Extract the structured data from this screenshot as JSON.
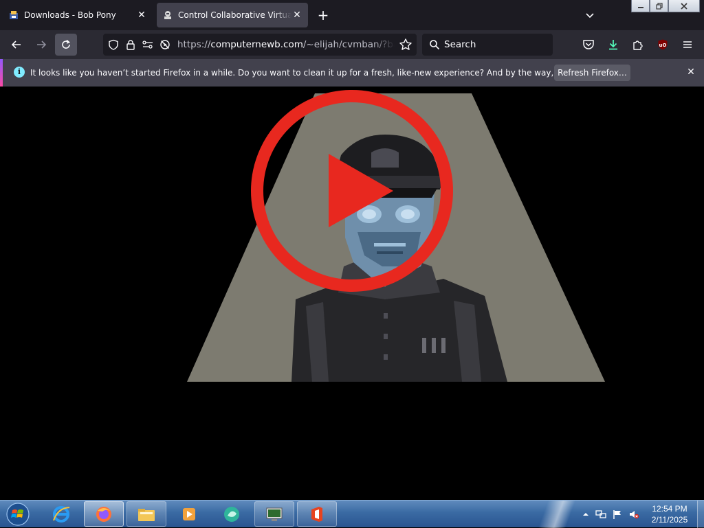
{
  "browser": {
    "tabs": [
      {
        "title": "Downloads - Bob Pony",
        "active": false
      },
      {
        "title": "Control Collaborative Virtual M",
        "active": true
      }
    ],
    "url": {
      "scheme": "https://",
      "host": "computernewb.com",
      "path": "/~elijah/cvmban/?banre"
    },
    "search_placeholder": "Search",
    "extension_badge_count": "2",
    "notification": {
      "text": "It looks like you haven’t started Firefox in a while. Do you want to clean it up for a fresh, like-new experience? And by the way, welcome back!",
      "button_label": "Refresh Firefox…"
    }
  },
  "content": {
    "video_overlay": "play-button-icon",
    "colors": {
      "play_red": "#e8281f",
      "spotlight": "#7d7b70",
      "face_blue": "#6f8fab"
    }
  },
  "taskbar": {
    "apps": [
      "internet-explorer",
      "firefox",
      "file-explorer",
      "media-player",
      "app-circle",
      "remote-desktop",
      "office"
    ],
    "clock": {
      "time": "12:54 PM",
      "date": "2/11/2025"
    }
  }
}
